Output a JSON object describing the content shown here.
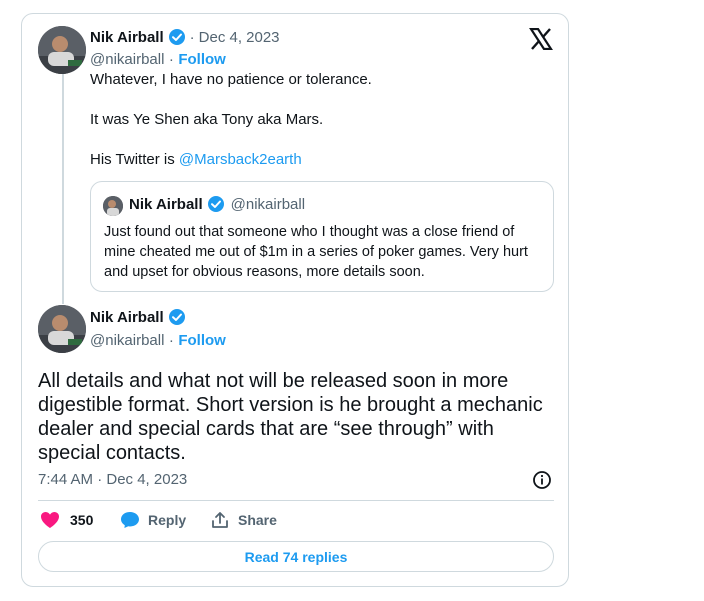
{
  "colors": {
    "accent": "#1d9bf0",
    "heart": "#f91880",
    "text": "#0f1419",
    "muted": "#536471",
    "border": "#cfd9de"
  },
  "first_tweet": {
    "name": "Nik Airball",
    "date_sep": "·",
    "date": "Dec 4, 2023",
    "handle": "@nikairball",
    "follow_sep": "·",
    "follow": "Follow",
    "line1": "Whatever, I have no patience or tolerance.",
    "line2": "It was Ye Shen aka Tony aka Mars.",
    "line3_prefix": "His Twitter is ",
    "line3_link": "@Marsback2earth"
  },
  "quote": {
    "name": "Nik Airball",
    "handle": "@nikairball",
    "text": "Just found out that someone who I thought was a close friend of mine cheated me out of $1m in a series of poker games. Very hurt and upset for obvious reasons, more details soon."
  },
  "main_tweet": {
    "name": "Nik Airball",
    "handle": "@nikairball",
    "follow_sep": "·",
    "follow": "Follow",
    "text": "All details and what not will be released soon in more digestible format. Short version is he brought a mechanic dealer and special cards that are “see through” with special contacts.",
    "timestamp": "7:44 AM · Dec 4, 2023"
  },
  "actions": {
    "likes": "350",
    "reply": "Reply",
    "share": "Share"
  },
  "read_replies": "Read 74 replies",
  "icons": [
    "x-logo-icon",
    "verified-badge-icon",
    "info-icon",
    "heart-icon",
    "reply-icon",
    "share-icon"
  ]
}
